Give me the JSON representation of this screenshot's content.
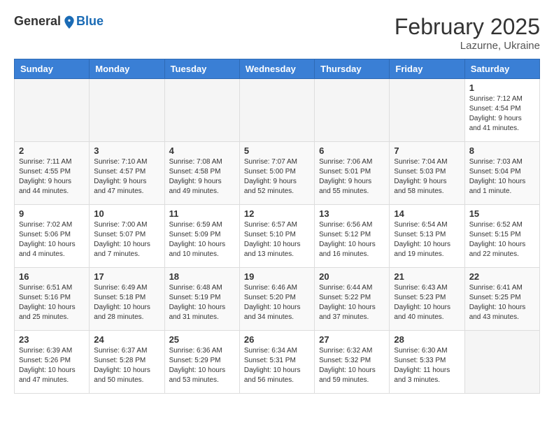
{
  "logo": {
    "general": "General",
    "blue": "Blue"
  },
  "header": {
    "month": "February 2025",
    "location": "Lazurne, Ukraine"
  },
  "weekdays": [
    "Sunday",
    "Monday",
    "Tuesday",
    "Wednesday",
    "Thursday",
    "Friday",
    "Saturday"
  ],
  "weeks": [
    [
      {
        "day": "",
        "info": ""
      },
      {
        "day": "",
        "info": ""
      },
      {
        "day": "",
        "info": ""
      },
      {
        "day": "",
        "info": ""
      },
      {
        "day": "",
        "info": ""
      },
      {
        "day": "",
        "info": ""
      },
      {
        "day": "1",
        "info": "Sunrise: 7:12 AM\nSunset: 4:54 PM\nDaylight: 9 hours and 41 minutes."
      }
    ],
    [
      {
        "day": "2",
        "info": "Sunrise: 7:11 AM\nSunset: 4:55 PM\nDaylight: 9 hours and 44 minutes."
      },
      {
        "day": "3",
        "info": "Sunrise: 7:10 AM\nSunset: 4:57 PM\nDaylight: 9 hours and 47 minutes."
      },
      {
        "day": "4",
        "info": "Sunrise: 7:08 AM\nSunset: 4:58 PM\nDaylight: 9 hours and 49 minutes."
      },
      {
        "day": "5",
        "info": "Sunrise: 7:07 AM\nSunset: 5:00 PM\nDaylight: 9 hours and 52 minutes."
      },
      {
        "day": "6",
        "info": "Sunrise: 7:06 AM\nSunset: 5:01 PM\nDaylight: 9 hours and 55 minutes."
      },
      {
        "day": "7",
        "info": "Sunrise: 7:04 AM\nSunset: 5:03 PM\nDaylight: 9 hours and 58 minutes."
      },
      {
        "day": "8",
        "info": "Sunrise: 7:03 AM\nSunset: 5:04 PM\nDaylight: 10 hours and 1 minute."
      }
    ],
    [
      {
        "day": "9",
        "info": "Sunrise: 7:02 AM\nSunset: 5:06 PM\nDaylight: 10 hours and 4 minutes."
      },
      {
        "day": "10",
        "info": "Sunrise: 7:00 AM\nSunset: 5:07 PM\nDaylight: 10 hours and 7 minutes."
      },
      {
        "day": "11",
        "info": "Sunrise: 6:59 AM\nSunset: 5:09 PM\nDaylight: 10 hours and 10 minutes."
      },
      {
        "day": "12",
        "info": "Sunrise: 6:57 AM\nSunset: 5:10 PM\nDaylight: 10 hours and 13 minutes."
      },
      {
        "day": "13",
        "info": "Sunrise: 6:56 AM\nSunset: 5:12 PM\nDaylight: 10 hours and 16 minutes."
      },
      {
        "day": "14",
        "info": "Sunrise: 6:54 AM\nSunset: 5:13 PM\nDaylight: 10 hours and 19 minutes."
      },
      {
        "day": "15",
        "info": "Sunrise: 6:52 AM\nSunset: 5:15 PM\nDaylight: 10 hours and 22 minutes."
      }
    ],
    [
      {
        "day": "16",
        "info": "Sunrise: 6:51 AM\nSunset: 5:16 PM\nDaylight: 10 hours and 25 minutes."
      },
      {
        "day": "17",
        "info": "Sunrise: 6:49 AM\nSunset: 5:18 PM\nDaylight: 10 hours and 28 minutes."
      },
      {
        "day": "18",
        "info": "Sunrise: 6:48 AM\nSunset: 5:19 PM\nDaylight: 10 hours and 31 minutes."
      },
      {
        "day": "19",
        "info": "Sunrise: 6:46 AM\nSunset: 5:20 PM\nDaylight: 10 hours and 34 minutes."
      },
      {
        "day": "20",
        "info": "Sunrise: 6:44 AM\nSunset: 5:22 PM\nDaylight: 10 hours and 37 minutes."
      },
      {
        "day": "21",
        "info": "Sunrise: 6:43 AM\nSunset: 5:23 PM\nDaylight: 10 hours and 40 minutes."
      },
      {
        "day": "22",
        "info": "Sunrise: 6:41 AM\nSunset: 5:25 PM\nDaylight: 10 hours and 43 minutes."
      }
    ],
    [
      {
        "day": "23",
        "info": "Sunrise: 6:39 AM\nSunset: 5:26 PM\nDaylight: 10 hours and 47 minutes."
      },
      {
        "day": "24",
        "info": "Sunrise: 6:37 AM\nSunset: 5:28 PM\nDaylight: 10 hours and 50 minutes."
      },
      {
        "day": "25",
        "info": "Sunrise: 6:36 AM\nSunset: 5:29 PM\nDaylight: 10 hours and 53 minutes."
      },
      {
        "day": "26",
        "info": "Sunrise: 6:34 AM\nSunset: 5:31 PM\nDaylight: 10 hours and 56 minutes."
      },
      {
        "day": "27",
        "info": "Sunrise: 6:32 AM\nSunset: 5:32 PM\nDaylight: 10 hours and 59 minutes."
      },
      {
        "day": "28",
        "info": "Sunrise: 6:30 AM\nSunset: 5:33 PM\nDaylight: 11 hours and 3 minutes."
      },
      {
        "day": "",
        "info": ""
      }
    ]
  ]
}
